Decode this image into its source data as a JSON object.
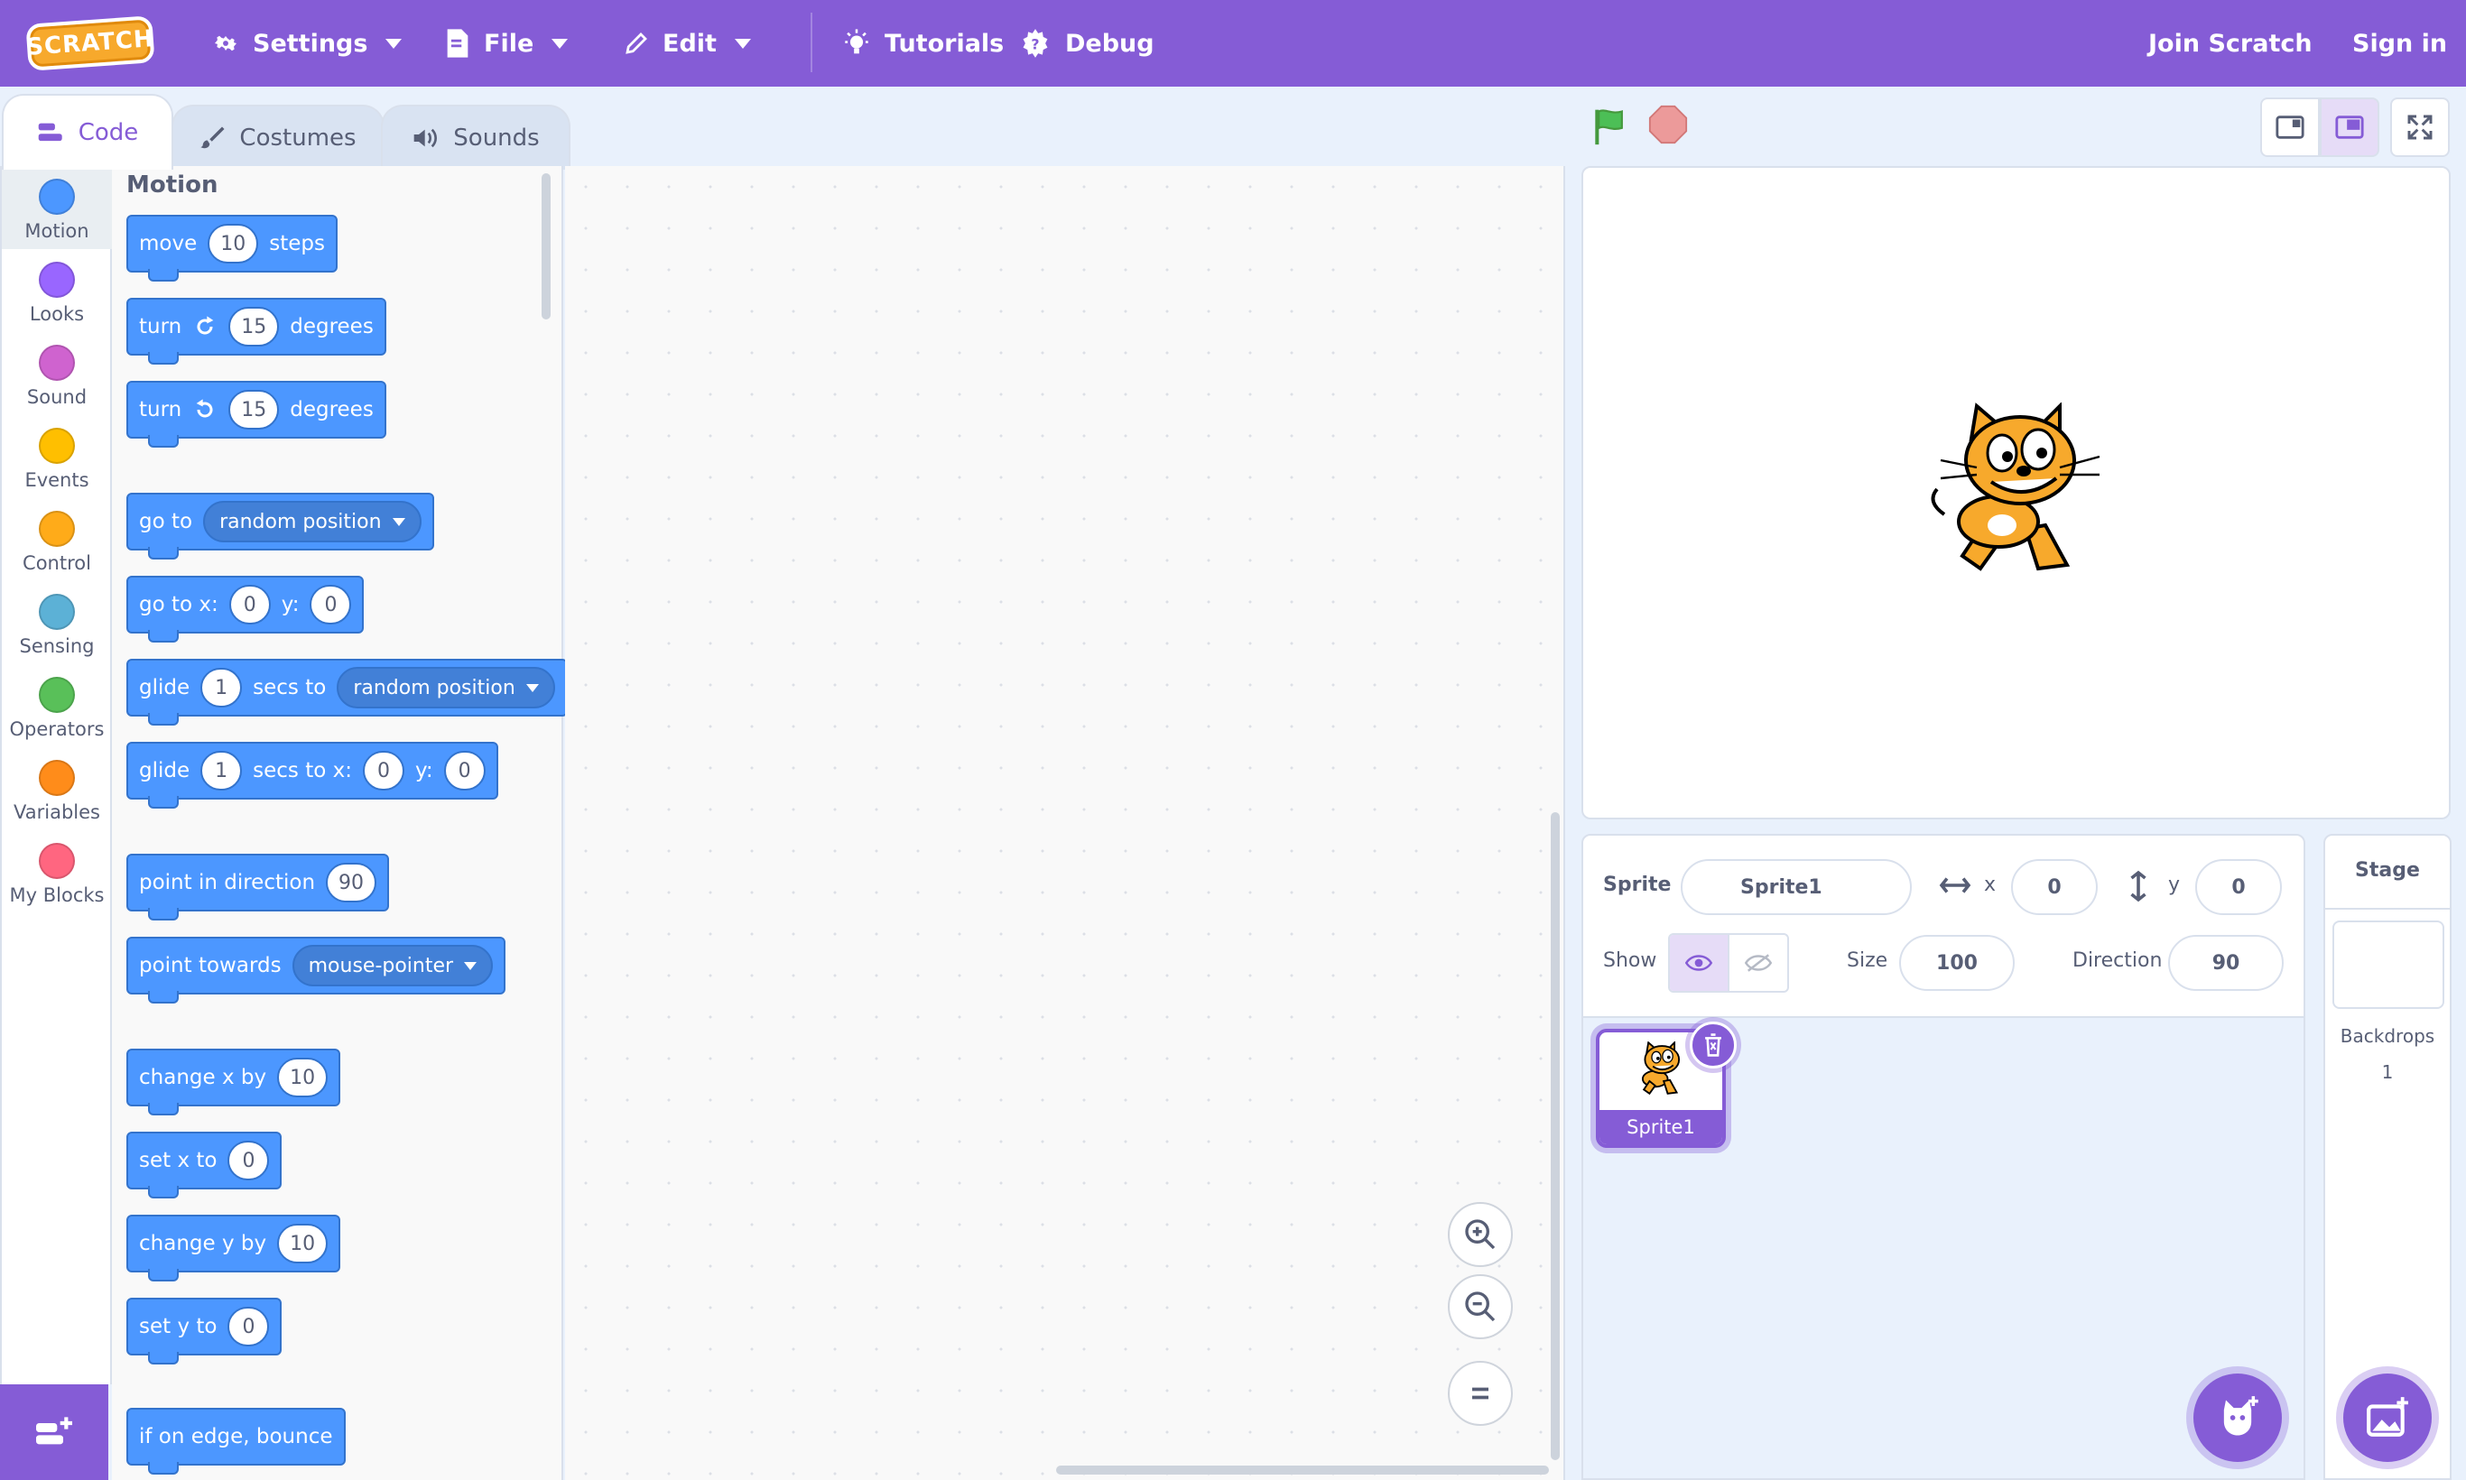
{
  "menubar": {
    "logo": "SCRATCH",
    "settings": "Settings",
    "file": "File",
    "edit": "Edit",
    "tutorials": "Tutorials",
    "debug": "Debug",
    "join": "Join Scratch",
    "signin": "Sign in"
  },
  "tabs": {
    "code": "Code",
    "costumes": "Costumes",
    "sounds": "Sounds"
  },
  "categories": [
    {
      "label": "Motion",
      "color": "#4c97ff"
    },
    {
      "label": "Looks",
      "color": "#9966ff"
    },
    {
      "label": "Sound",
      "color": "#cf63cf"
    },
    {
      "label": "Events",
      "color": "#ffbf00"
    },
    {
      "label": "Control",
      "color": "#ffab19"
    },
    {
      "label": "Sensing",
      "color": "#5cb1d6"
    },
    {
      "label": "Operators",
      "color": "#59c059"
    },
    {
      "label": "Variables",
      "color": "#ff8c1a"
    },
    {
      "label": "My Blocks",
      "color": "#ff6680"
    }
  ],
  "flyout": {
    "title": "Motion",
    "move": {
      "a": "move",
      "v": "10",
      "b": "steps"
    },
    "turn_right": {
      "a": "turn",
      "v": "15",
      "b": "degrees"
    },
    "turn_left": {
      "a": "turn",
      "v": "15",
      "b": "degrees"
    },
    "goto": {
      "a": "go to",
      "d": "random position"
    },
    "goto_xy": {
      "a": "go to x:",
      "x": "0",
      "b": "y:",
      "y": "0"
    },
    "glide_to": {
      "a": "glide",
      "v": "1",
      "b": "secs to",
      "d": "random position"
    },
    "glide_xy": {
      "a": "glide",
      "v": "1",
      "b": "secs to x:",
      "x": "0",
      "c": "y:",
      "y": "0"
    },
    "point_dir": {
      "a": "point in direction",
      "v": "90"
    },
    "point_towards": {
      "a": "point towards",
      "d": "mouse-pointer"
    },
    "change_x": {
      "a": "change x by",
      "v": "10"
    },
    "set_x": {
      "a": "set x to",
      "v": "0"
    },
    "change_y": {
      "a": "change y by",
      "v": "10"
    },
    "set_y": {
      "a": "set y to",
      "v": "0"
    },
    "bounce": {
      "a": "if on edge, bounce"
    }
  },
  "sprite_info": {
    "sprite_label": "Sprite",
    "sprite_name": "Sprite1",
    "x_label": "x",
    "x_value": "0",
    "y_label": "y",
    "y_value": "0",
    "show_label": "Show",
    "size_label": "Size",
    "size_value": "100",
    "direction_label": "Direction",
    "direction_value": "90"
  },
  "sprites": [
    {
      "name": "Sprite1"
    }
  ],
  "stage_panel": {
    "title": "Stage",
    "backdrops_label": "Backdrops",
    "backdrops_count": "1"
  },
  "colors": {
    "accent": "#855cd6",
    "motion": "#4c97ff",
    "green_flag": "#4cbf56",
    "stop": "#ec5959"
  },
  "icons": [
    "gear-icon",
    "file-icon",
    "edit-icon",
    "lightbulb-icon",
    "debug-icon",
    "code-icon",
    "brush-icon",
    "speaker-icon",
    "green-flag-icon",
    "stop-icon",
    "small-stage-icon",
    "normal-stage-icon",
    "fullscreen-icon",
    "zoom-in-icon",
    "zoom-out-icon",
    "zoom-reset-icon",
    "eye-icon",
    "eye-off-icon",
    "trash-icon",
    "add-extension-icon",
    "choose-sprite-icon",
    "choose-backdrop-icon"
  ]
}
